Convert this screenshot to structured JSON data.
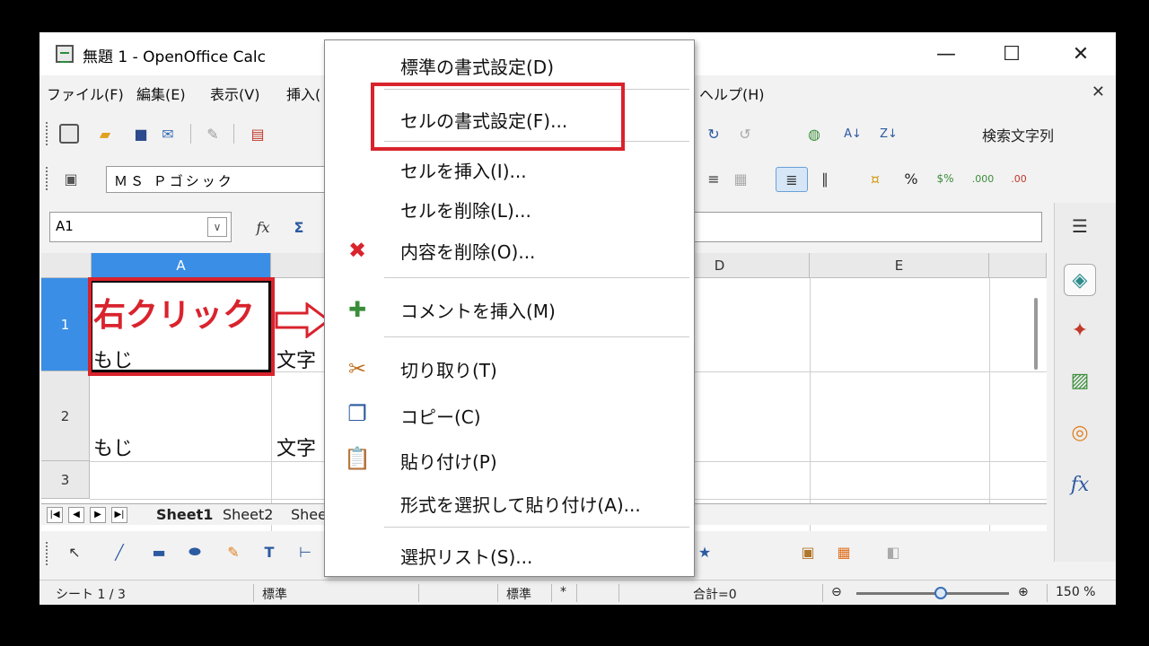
{
  "window": {
    "title": "無題 1 - OpenOffice Calc",
    "minimize": "—",
    "maximize": "☐",
    "close": "✕"
  },
  "menubar": {
    "items": [
      "ファイル(F)",
      "編集(E)",
      "表示(V)",
      "挿入(",
      "ヘルプ(H)"
    ],
    "close": "✕"
  },
  "toolbar": {
    "search_placeholder": "検索文字列",
    "font_name": "ＭＳ Ｐゴシック"
  },
  "formula_bar": {
    "cell_ref": "A1"
  },
  "grid": {
    "columns": [
      "A",
      "D",
      "E"
    ],
    "rows": [
      "1",
      "2",
      "3"
    ],
    "cells": {
      "a1": "もじ",
      "b1_partial": "文字",
      "a2": "もじ",
      "b2_partial": "文字"
    }
  },
  "sheet_tabs": [
    "Sheet1",
    "Sheet2",
    "Shee"
  ],
  "statusbar": {
    "sheet": "シート 1 / 3",
    "style": "標準",
    "mode": "標準",
    "modified": "*",
    "sum": "合計=0",
    "zoom": "150 %"
  },
  "annotation": {
    "right_click": "右クリック"
  },
  "context_menu": {
    "items": [
      {
        "label": "標準の書式設定(D)",
        "icon": ""
      },
      {
        "label": "セルの書式設定(F)...",
        "icon": ""
      },
      {
        "label": "セルを挿入(I)...",
        "icon": ""
      },
      {
        "label": "セルを削除(L)...",
        "icon": ""
      },
      {
        "label": "内容を削除(O)...",
        "icon": "delete-x-icon"
      },
      {
        "label": "コメントを挿入(M)",
        "icon": "insert-comment-icon"
      },
      {
        "label": "切り取り(T)",
        "icon": "scissors-icon"
      },
      {
        "label": "コピー(C)",
        "icon": "copy-icon"
      },
      {
        "label": "貼り付け(P)",
        "icon": "clipboard-icon"
      },
      {
        "label": "形式を選択して貼り付け(A)...",
        "icon": ""
      },
      {
        "label": "選択リスト(S)...",
        "icon": ""
      }
    ]
  },
  "colors": {
    "highlight": "#d9232d",
    "selection": "#3a8ee6"
  }
}
